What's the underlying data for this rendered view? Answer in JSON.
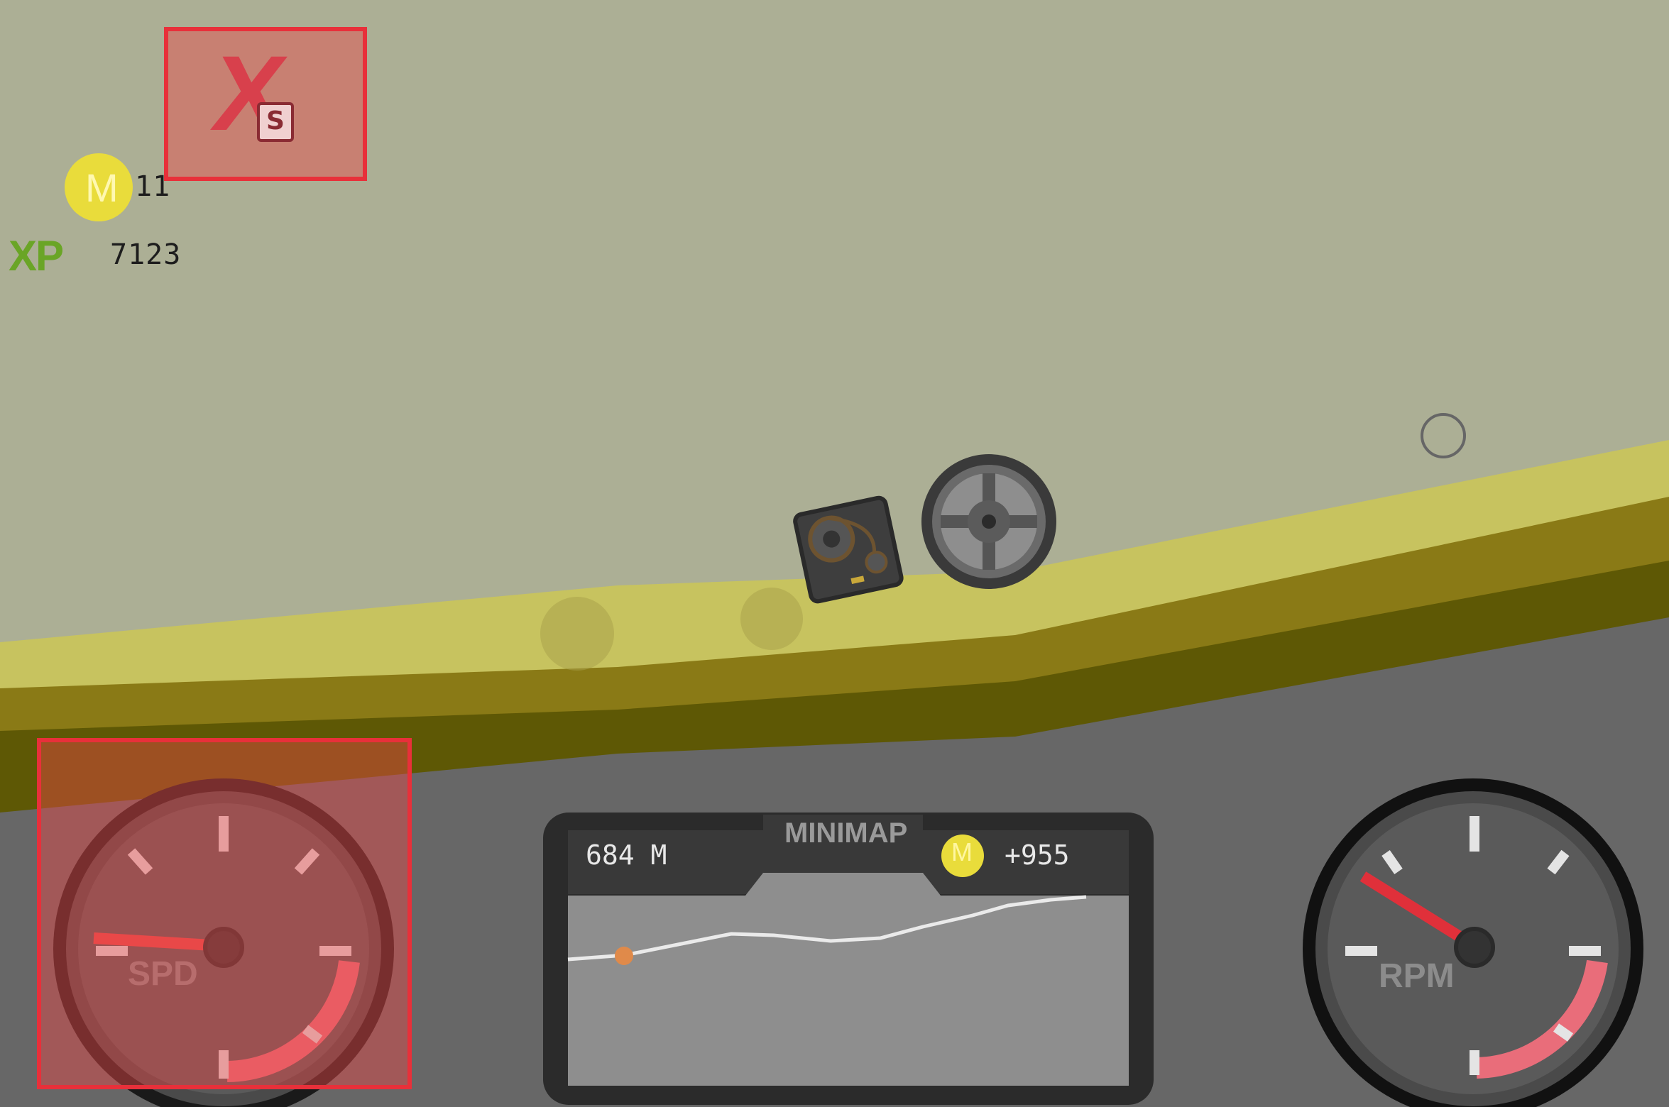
{
  "hud": {
    "coins": "11",
    "coin_symbol": "M",
    "xp_label": "XP",
    "xp": "7123",
    "close_symbol": "X",
    "close_sub": "S"
  },
  "minimap": {
    "title": "MINIMAP",
    "distance": "684 M",
    "coin_symbol": "M",
    "coin_total": "+955",
    "progress": 0.1
  },
  "gauges": {
    "speed_label": "SPD",
    "rpm_label": "RPM"
  },
  "colors": {
    "sky": "#acaf95",
    "ground_top": "#c7c35f",
    "ground_mid": "#8a7a16",
    "ground_dark": "#5e5805",
    "dashboard": "#676767",
    "accent_red": "#e8303a",
    "needle": "#e84a4a",
    "coin": "#e9dc3b"
  }
}
